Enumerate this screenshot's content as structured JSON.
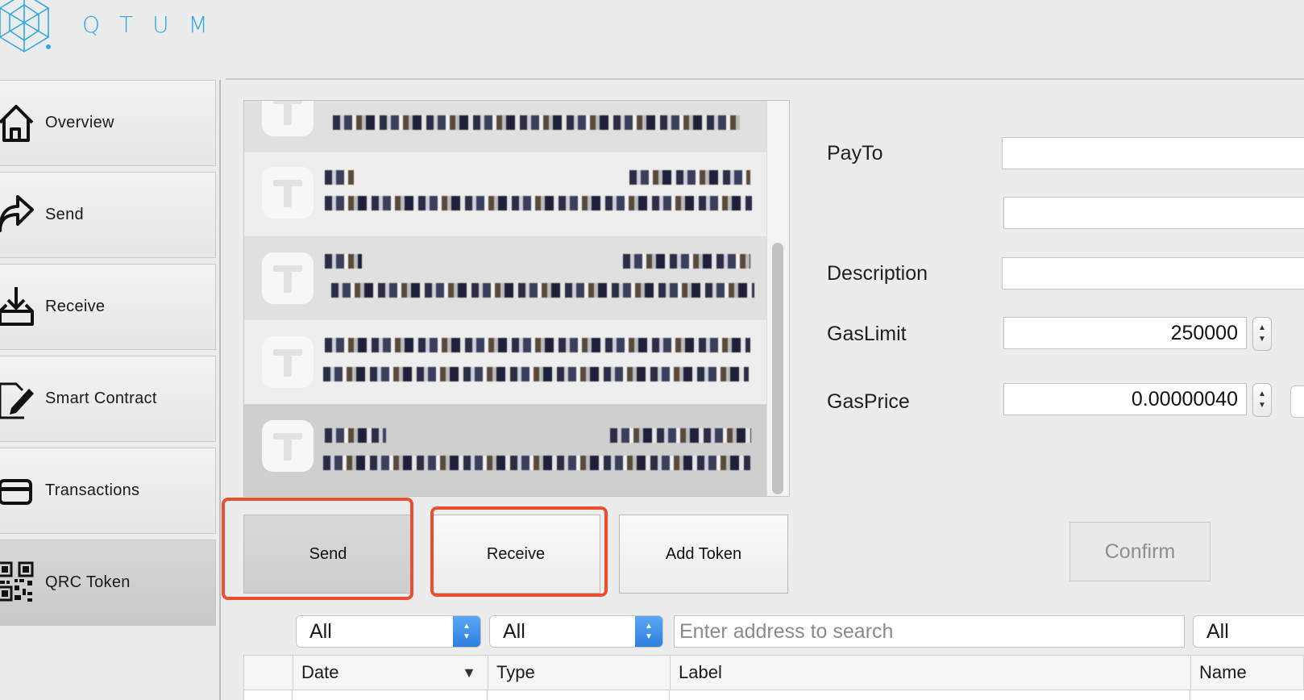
{
  "app": {
    "logo_text": "QTUM",
    "accent": "#2fa8e0",
    "highlight_color": "#ea4f2f"
  },
  "sidebar": {
    "items": [
      {
        "label": "Overview",
        "icon": "home-icon",
        "active": false
      },
      {
        "label": "Send",
        "icon": "send-arrow-icon",
        "active": false
      },
      {
        "label": "Receive",
        "icon": "receive-tray-icon",
        "active": false
      },
      {
        "label": "Smart Contract",
        "icon": "contract-pen-icon",
        "active": false
      },
      {
        "label": "Transactions",
        "icon": "card-icon",
        "active": false
      },
      {
        "label": "QRC Token",
        "icon": "qr-code-icon",
        "active": true
      }
    ]
  },
  "token_list": {
    "row_count": 5,
    "selected_index": 4
  },
  "actions": {
    "send_label": "Send",
    "receive_label": "Receive",
    "add_token_label": "Add Token"
  },
  "form": {
    "payto_label": "PayTo",
    "amount_label": "",
    "description_label": "Description",
    "gaslimit_label": "GasLimit",
    "gaslimit_value": "250000",
    "gasprice_label": "GasPrice",
    "gasprice_value": "0.00000040",
    "confirm_label": "Confirm"
  },
  "filters": {
    "date_select": "All",
    "type_select": "All",
    "search_placeholder": "Enter address to search",
    "name_select": "All"
  },
  "table": {
    "columns": [
      "Date",
      "Type",
      "Label",
      "Name"
    ]
  }
}
